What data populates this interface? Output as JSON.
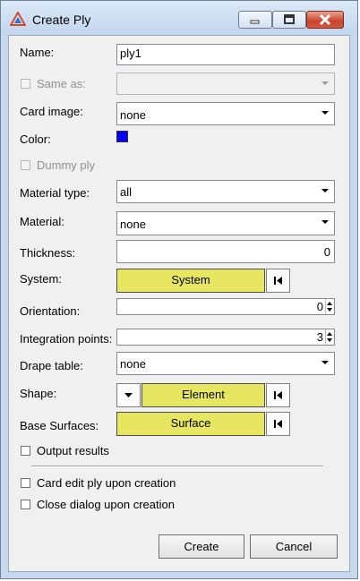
{
  "window": {
    "title": "Create Ply"
  },
  "labels": {
    "name": "Name:",
    "same_as": "Same as:",
    "card_image": "Card image:",
    "color": "Color:",
    "dummy_ply": "Dummy ply",
    "material_type": "Material type:",
    "material": "Material:",
    "thickness": "Thickness:",
    "system": "System:",
    "orientation": "Orientation:",
    "integration_points": "Integration points:",
    "drape_table": "Drape table:",
    "shape": "Shape:",
    "base_surfaces": "Base Surfaces:",
    "output_results": "Output results",
    "card_edit": "Card edit ply upon creation",
    "close_dialog": "Close dialog upon creation"
  },
  "values": {
    "name": "ply1",
    "same_as": "",
    "card_image": "none",
    "color": "#0000ff",
    "material_type": "all",
    "material": "none",
    "thickness": "0",
    "system_button": "System",
    "orientation": "0",
    "integration_points": "3",
    "drape_table": "none",
    "shape_button": "Element",
    "base_surfaces_button": "Surface"
  },
  "checkboxes": {
    "same_as": false,
    "dummy_ply": false,
    "output_results": false,
    "card_edit": false,
    "close_dialog": false
  },
  "buttons": {
    "create": "Create",
    "cancel": "Cancel"
  },
  "icons": {
    "app": "hypermesh-logo-icon",
    "minimize": "minimize-icon",
    "maximize": "maximize-icon",
    "close": "close-icon",
    "reset": "skip-back-icon",
    "dropdown": "chevron-down-icon"
  }
}
